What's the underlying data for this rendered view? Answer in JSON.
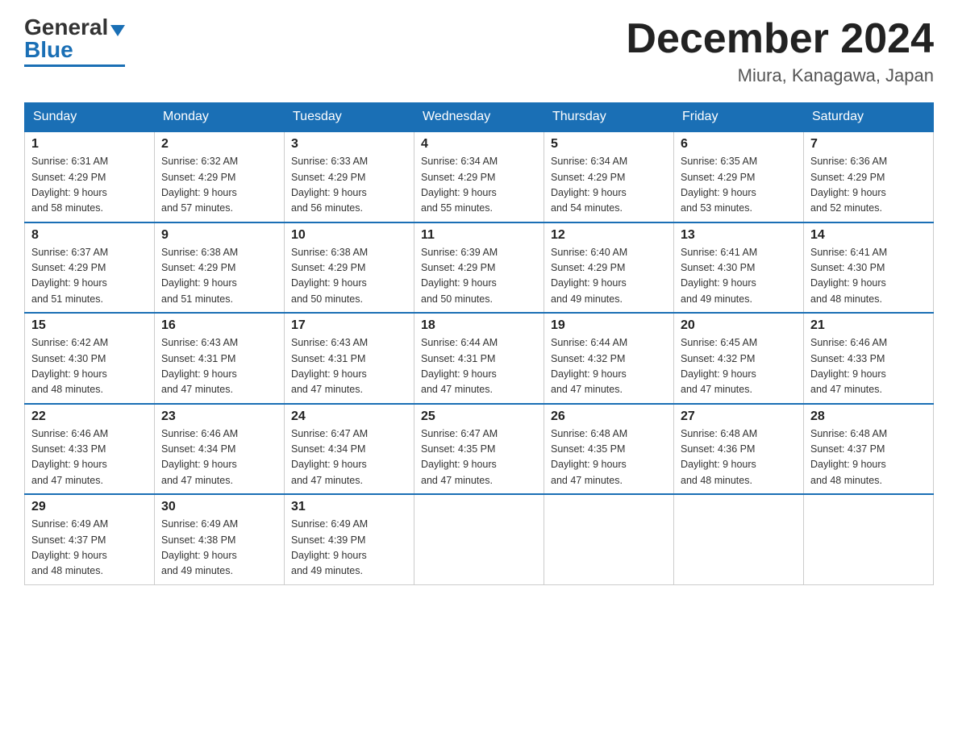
{
  "logo": {
    "general": "General",
    "blue": "Blue"
  },
  "title": "December 2024",
  "location": "Miura, Kanagawa, Japan",
  "weekdays": [
    "Sunday",
    "Monday",
    "Tuesday",
    "Wednesday",
    "Thursday",
    "Friday",
    "Saturday"
  ],
  "weeks": [
    [
      {
        "day": "1",
        "sunrise": "6:31 AM",
        "sunset": "4:29 PM",
        "daylight": "9 hours and 58 minutes."
      },
      {
        "day": "2",
        "sunrise": "6:32 AM",
        "sunset": "4:29 PM",
        "daylight": "9 hours and 57 minutes."
      },
      {
        "day": "3",
        "sunrise": "6:33 AM",
        "sunset": "4:29 PM",
        "daylight": "9 hours and 56 minutes."
      },
      {
        "day": "4",
        "sunrise": "6:34 AM",
        "sunset": "4:29 PM",
        "daylight": "9 hours and 55 minutes."
      },
      {
        "day": "5",
        "sunrise": "6:34 AM",
        "sunset": "4:29 PM",
        "daylight": "9 hours and 54 minutes."
      },
      {
        "day": "6",
        "sunrise": "6:35 AM",
        "sunset": "4:29 PM",
        "daylight": "9 hours and 53 minutes."
      },
      {
        "day": "7",
        "sunrise": "6:36 AM",
        "sunset": "4:29 PM",
        "daylight": "9 hours and 52 minutes."
      }
    ],
    [
      {
        "day": "8",
        "sunrise": "6:37 AM",
        "sunset": "4:29 PM",
        "daylight": "9 hours and 51 minutes."
      },
      {
        "day": "9",
        "sunrise": "6:38 AM",
        "sunset": "4:29 PM",
        "daylight": "9 hours and 51 minutes."
      },
      {
        "day": "10",
        "sunrise": "6:38 AM",
        "sunset": "4:29 PM",
        "daylight": "9 hours and 50 minutes."
      },
      {
        "day": "11",
        "sunrise": "6:39 AM",
        "sunset": "4:29 PM",
        "daylight": "9 hours and 50 minutes."
      },
      {
        "day": "12",
        "sunrise": "6:40 AM",
        "sunset": "4:29 PM",
        "daylight": "9 hours and 49 minutes."
      },
      {
        "day": "13",
        "sunrise": "6:41 AM",
        "sunset": "4:30 PM",
        "daylight": "9 hours and 49 minutes."
      },
      {
        "day": "14",
        "sunrise": "6:41 AM",
        "sunset": "4:30 PM",
        "daylight": "9 hours and 48 minutes."
      }
    ],
    [
      {
        "day": "15",
        "sunrise": "6:42 AM",
        "sunset": "4:30 PM",
        "daylight": "9 hours and 48 minutes."
      },
      {
        "day": "16",
        "sunrise": "6:43 AM",
        "sunset": "4:31 PM",
        "daylight": "9 hours and 47 minutes."
      },
      {
        "day": "17",
        "sunrise": "6:43 AM",
        "sunset": "4:31 PM",
        "daylight": "9 hours and 47 minutes."
      },
      {
        "day": "18",
        "sunrise": "6:44 AM",
        "sunset": "4:31 PM",
        "daylight": "9 hours and 47 minutes."
      },
      {
        "day": "19",
        "sunrise": "6:44 AM",
        "sunset": "4:32 PM",
        "daylight": "9 hours and 47 minutes."
      },
      {
        "day": "20",
        "sunrise": "6:45 AM",
        "sunset": "4:32 PM",
        "daylight": "9 hours and 47 minutes."
      },
      {
        "day": "21",
        "sunrise": "6:46 AM",
        "sunset": "4:33 PM",
        "daylight": "9 hours and 47 minutes."
      }
    ],
    [
      {
        "day": "22",
        "sunrise": "6:46 AM",
        "sunset": "4:33 PM",
        "daylight": "9 hours and 47 minutes."
      },
      {
        "day": "23",
        "sunrise": "6:46 AM",
        "sunset": "4:34 PM",
        "daylight": "9 hours and 47 minutes."
      },
      {
        "day": "24",
        "sunrise": "6:47 AM",
        "sunset": "4:34 PM",
        "daylight": "9 hours and 47 minutes."
      },
      {
        "day": "25",
        "sunrise": "6:47 AM",
        "sunset": "4:35 PM",
        "daylight": "9 hours and 47 minutes."
      },
      {
        "day": "26",
        "sunrise": "6:48 AM",
        "sunset": "4:35 PM",
        "daylight": "9 hours and 47 minutes."
      },
      {
        "day": "27",
        "sunrise": "6:48 AM",
        "sunset": "4:36 PM",
        "daylight": "9 hours and 48 minutes."
      },
      {
        "day": "28",
        "sunrise": "6:48 AM",
        "sunset": "4:37 PM",
        "daylight": "9 hours and 48 minutes."
      }
    ],
    [
      {
        "day": "29",
        "sunrise": "6:49 AM",
        "sunset": "4:37 PM",
        "daylight": "9 hours and 48 minutes."
      },
      {
        "day": "30",
        "sunrise": "6:49 AM",
        "sunset": "4:38 PM",
        "daylight": "9 hours and 49 minutes."
      },
      {
        "day": "31",
        "sunrise": "6:49 AM",
        "sunset": "4:39 PM",
        "daylight": "9 hours and 49 minutes."
      },
      null,
      null,
      null,
      null
    ]
  ],
  "labels": {
    "sunrise": "Sunrise:",
    "sunset": "Sunset:",
    "daylight": "Daylight:"
  }
}
